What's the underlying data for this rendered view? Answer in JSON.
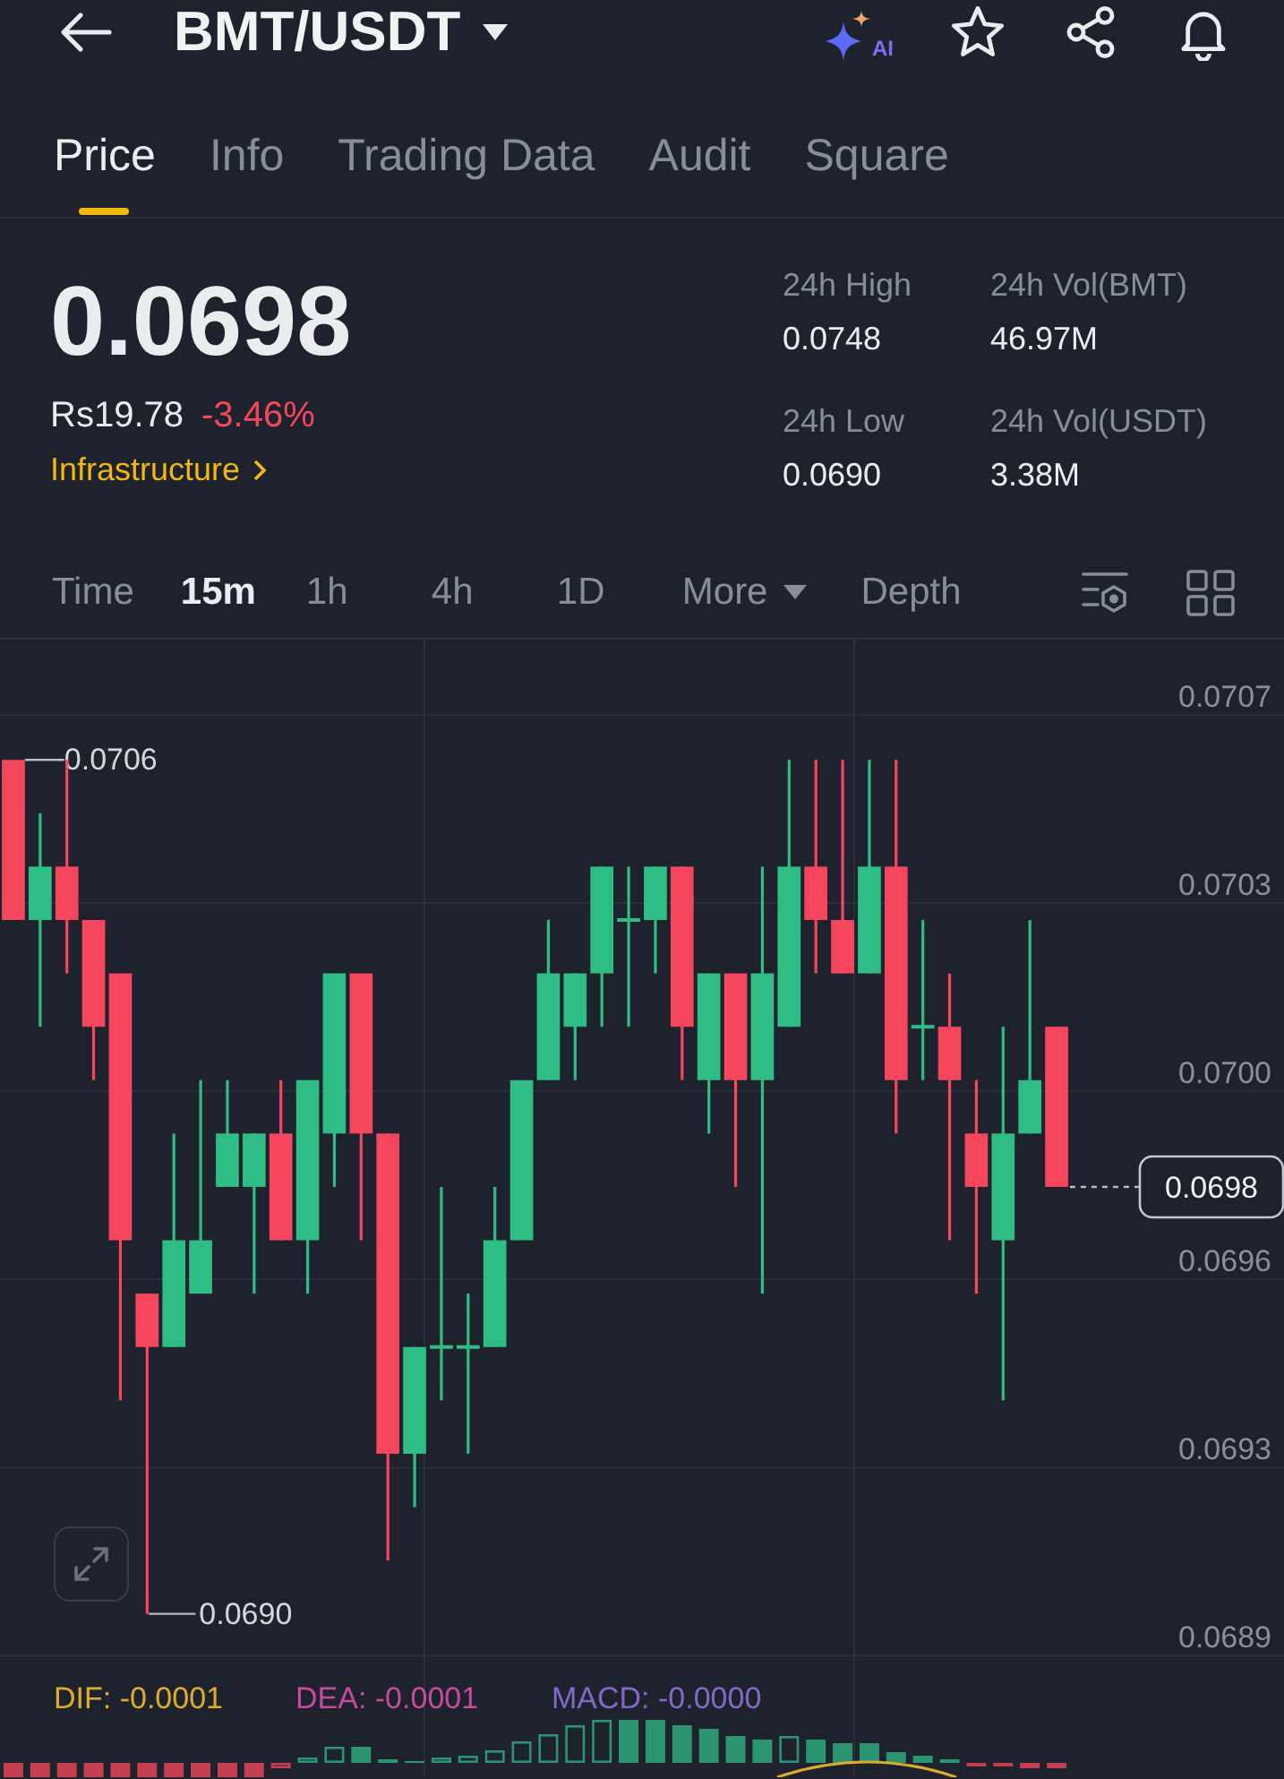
{
  "header": {
    "title": "BMT/USDT",
    "ai_label": "AI"
  },
  "tabs": [
    {
      "label": "Price",
      "selected": true
    },
    {
      "label": "Info",
      "selected": false
    },
    {
      "label": "Trading Data",
      "selected": false
    },
    {
      "label": "Audit",
      "selected": false
    },
    {
      "label": "Square",
      "selected": false
    }
  ],
  "ticker": {
    "last_price": "0.0698",
    "fiat_price": "Rs19.78",
    "change": "-3.46%",
    "down": true,
    "sector": "Infrastructure"
  },
  "stats": [
    {
      "label": "24h High",
      "value": "0.0748"
    },
    {
      "label": "24h Vol(BMT)",
      "value": "46.97M"
    },
    {
      "label": "24h Low",
      "value": "0.0690"
    },
    {
      "label": "24h Vol(USDT)",
      "value": "3.38M"
    }
  ],
  "intervals": [
    {
      "label": "Time",
      "kind": "option",
      "selected": false
    },
    {
      "label": "15m",
      "kind": "option",
      "selected": true
    },
    {
      "label": "1h",
      "kind": "option",
      "selected": false
    },
    {
      "label": "4h",
      "kind": "option",
      "selected": false
    },
    {
      "label": "1D",
      "kind": "option",
      "selected": false
    },
    {
      "label": "More",
      "kind": "dropdown",
      "selected": false
    },
    {
      "label": "Depth",
      "kind": "option",
      "selected": false
    }
  ],
  "chart": {
    "chart_data": {
      "type": "candlestick",
      "grid": true,
      "categories": [
        null,
        null,
        null,
        null,
        null,
        null,
        null,
        null,
        null,
        null,
        null,
        null,
        null,
        null,
        null,
        null,
        null,
        null,
        null,
        null,
        null,
        null,
        null,
        null,
        null,
        null,
        null,
        null,
        null,
        null,
        null,
        null,
        null,
        null,
        null,
        null,
        null,
        null,
        null,
        null,
        null,
        null,
        null,
        null,
        null,
        null,
        null,
        null
      ],
      "ylim": [
        0.068694,
        0.072027
      ],
      "ohlc": [
        [
          0.0706,
          0.0706,
          0.0703,
          0.0703
        ],
        [
          0.0703,
          0.0705,
          0.0701,
          0.0704
        ],
        [
          0.0704,
          0.0706,
          0.0702,
          0.0703
        ],
        [
          0.0703,
          0.0703,
          0.07,
          0.0701
        ],
        [
          0.0702,
          0.0702,
          0.0694,
          0.0697
        ],
        [
          0.0696,
          0.0696,
          0.069,
          0.0695
        ],
        [
          0.0695,
          0.0699,
          0.0695,
          0.0697
        ],
        [
          0.0696,
          0.07,
          0.0696,
          0.0697
        ],
        [
          0.0698,
          0.07,
          0.0698,
          0.0699
        ],
        [
          0.0698,
          0.0699,
          0.0696,
          0.0699
        ],
        [
          0.0699,
          0.07,
          0.0697,
          0.0697
        ],
        [
          0.0697,
          0.07,
          0.0696,
          0.07
        ],
        [
          0.0699,
          0.0702,
          0.0698,
          0.0702
        ],
        [
          0.0702,
          0.0702,
          0.0697,
          0.0699
        ],
        [
          0.0699,
          0.0699,
          0.0691,
          0.0693
        ],
        [
          0.0693,
          0.0695,
          0.0692,
          0.0695
        ],
        [
          0.0695,
          0.0698,
          0.0694,
          0.0695
        ],
        [
          0.0695,
          0.0696,
          0.0693,
          0.0695
        ],
        [
          0.0695,
          0.0698,
          0.0695,
          0.0697
        ],
        [
          0.0697,
          0.07,
          0.0697,
          0.07
        ],
        [
          0.07,
          0.0703,
          0.07,
          0.0702
        ],
        [
          0.0701,
          0.0702,
          0.07,
          0.0702
        ],
        [
          0.0702,
          0.0704,
          0.0701,
          0.0704
        ],
        [
          0.0703,
          0.0704,
          0.0701,
          0.0703
        ],
        [
          0.0703,
          0.0704,
          0.0702,
          0.0704
        ],
        [
          0.0704,
          0.0704,
          0.07,
          0.0701
        ],
        [
          0.07,
          0.0702,
          0.0699,
          0.0702
        ],
        [
          0.0702,
          0.0702,
          0.0698,
          0.07
        ],
        [
          0.07,
          0.0704,
          0.0696,
          0.0702
        ],
        [
          0.0701,
          0.0706,
          0.0701,
          0.0704
        ],
        [
          0.0704,
          0.0706,
          0.0702,
          0.0703
        ],
        [
          0.0703,
          0.0706,
          0.0702,
          0.0702
        ],
        [
          0.0702,
          0.0706,
          0.0702,
          0.0704
        ],
        [
          0.0704,
          0.0706,
          0.0699,
          0.07
        ],
        [
          0.0701,
          0.0703,
          0.07,
          0.0701
        ],
        [
          0.0701,
          0.0702,
          0.0697,
          0.07
        ],
        [
          0.0699,
          0.07,
          0.0696,
          0.0698
        ],
        [
          0.0697,
          0.0701,
          0.0694,
          0.0699
        ],
        [
          0.0699,
          0.0703,
          0.0699,
          0.07
        ],
        [
          0.0701,
          0.0701,
          0.0698,
          0.0698
        ],
        null,
        null,
        null,
        null,
        null,
        null,
        null,
        null
      ],
      "yticks": [
        {
          "value": 0.070684,
          "label": "0.0707"
        },
        {
          "value": 0.070332,
          "label": "0.0703"
        },
        {
          "value": 0.069979,
          "label": "0.0700"
        },
        {
          "value": 0.069627,
          "label": "0.0696"
        },
        {
          "value": 0.069274,
          "label": "0.0693"
        },
        {
          "value": 0.068922,
          "label": "0.0689"
        }
      ]
    },
    "high_label": "0.0706",
    "low_label": "0.0690",
    "current_price": "0.0698"
  },
  "macd": {
    "legend": [
      {
        "label": "DIF: -0.0001",
        "color": "#dcac2e"
      },
      {
        "label": "DEA: -0.0001",
        "color": "#c64b9d"
      },
      {
        "label": "MACD: -0.0000",
        "color": "#8468c8"
      }
    ]
  }
}
